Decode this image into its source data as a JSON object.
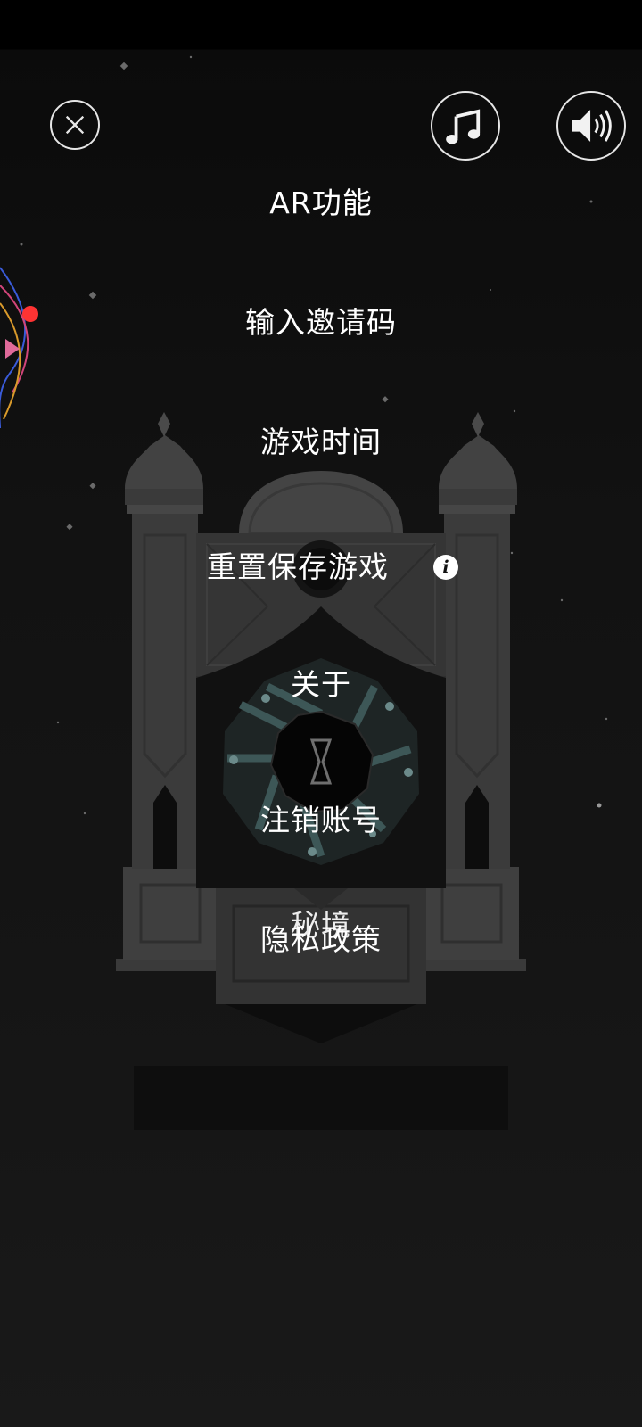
{
  "menu": {
    "ar": "AR功能",
    "invite_code": "输入邀请码",
    "play_time": "游戏时间",
    "reset_save": "重置保存游戏",
    "info_glyph": "i",
    "about": "关于",
    "delete_account": "注销账号",
    "privacy_policy": "隐私政策"
  },
  "level_title": "秘境",
  "buttons": {
    "close": "close-icon",
    "music": "music-note-icon",
    "sound": "speaker-icon"
  },
  "colors": {
    "background": "#121212",
    "text": "#ffffff",
    "notification": "#ff3333"
  }
}
